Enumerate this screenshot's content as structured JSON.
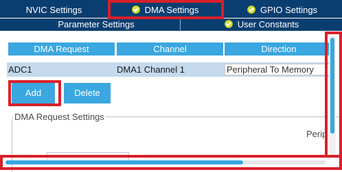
{
  "top_tabs": [
    {
      "label": "NVIC Settings",
      "checked": false
    },
    {
      "label": "DMA Settings",
      "checked": true
    },
    {
      "label": "GPIO Settings",
      "checked": true
    }
  ],
  "sub_tabs": [
    {
      "label": "Parameter Settings",
      "checked": false
    },
    {
      "label": "User Constants",
      "checked": true
    }
  ],
  "table": {
    "headers": [
      "DMA Request",
      "Channel",
      "Direction"
    ],
    "rows": [
      {
        "request": "ADC1",
        "channel": "DMA1 Channel 1",
        "direction": "Peripheral To Memory"
      }
    ]
  },
  "buttons": {
    "add": "Add",
    "delete": "Delete"
  },
  "group": {
    "legend": "DMA Request Settings",
    "clipped_label": "Perip"
  },
  "colors": {
    "tab_bar": "#0b3e70",
    "accent": "#3aa7e0",
    "highlight": "#d8202a",
    "row": "#c4d9ec",
    "check": "#cfe33a"
  }
}
